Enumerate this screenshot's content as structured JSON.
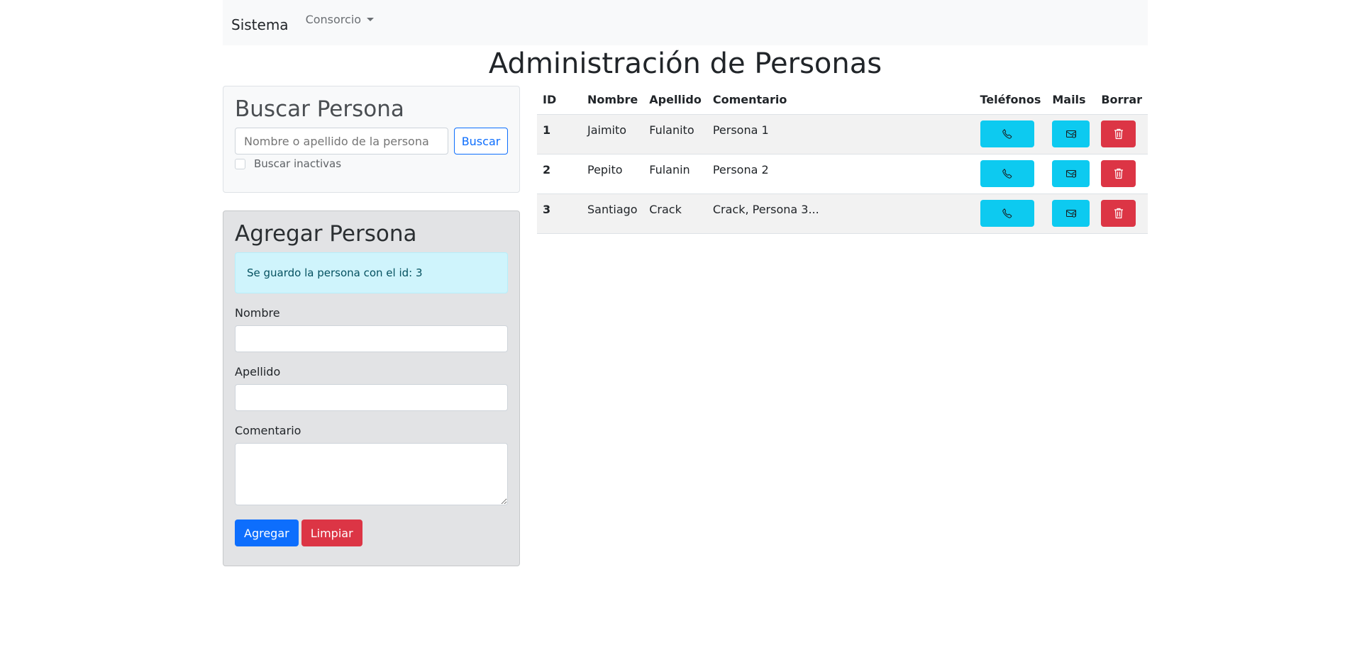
{
  "navbar": {
    "brand": "Sistema",
    "dropdown_label": "Consorcio"
  },
  "page_title": "Administración de Personas",
  "search": {
    "title": "Buscar Persona",
    "placeholder": "Nombre o apellido de la persona",
    "button_label": "Buscar",
    "inactive_label": "Buscar inactivas"
  },
  "add": {
    "title": "Agregar Persona",
    "alert": "Se guardo la persona con el id: 3",
    "nombre_label": "Nombre",
    "apellido_label": "Apellido",
    "comentario_label": "Comentario",
    "add_button": "Agregar",
    "clear_button": "Limpiar"
  },
  "table": {
    "headers": [
      "ID",
      "Nombre",
      "Apellido",
      "Comentario",
      "Teléfonos",
      "Mails",
      "Borrar"
    ],
    "rows": [
      {
        "id": "1",
        "nombre": "Jaimito",
        "apellido": "Fulanito",
        "comentario": "Persona 1"
      },
      {
        "id": "2",
        "nombre": "Pepito",
        "apellido": "Fulanin",
        "comentario": "Persona 2"
      },
      {
        "id": "3",
        "nombre": "Santiago",
        "apellido": "Crack",
        "comentario": "Crack, Persona 3..."
      }
    ]
  },
  "icons": {
    "phone": "phone-icon",
    "mail": "mail-icon",
    "delete": "trash-icon"
  },
  "colors": {
    "primary": "#0d6efd",
    "info": "#0dcaf0",
    "danger": "#dc3545"
  }
}
